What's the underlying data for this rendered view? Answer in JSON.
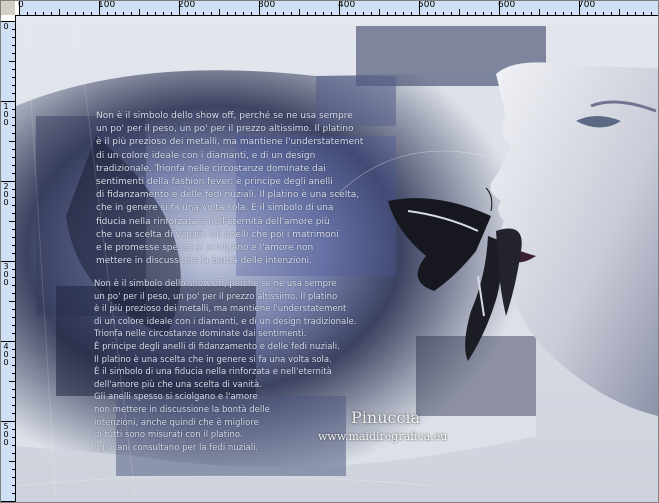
{
  "ruler": {
    "horizontal_labels": [
      "0",
      "100",
      "200",
      "300",
      "400",
      "500",
      "600",
      "700"
    ],
    "vertical_labels": [
      "0",
      "100",
      "200",
      "300",
      "400",
      "500",
      "600"
    ]
  },
  "artwork": {
    "paragraph_1": [
      "Non è il simbolo dello show off, perché se ne usa sempre",
      "un po' per il peso, un po' per il prezzo altissimo. Il platino",
      "è il più prezioso dei metalli, ma mantiene l'understatement",
      "di un colore ideale con i diamanti, e di un design",
      "tradizionale. Trionfa nelle circostanze dominate dai",
      "sentimenti della fashion fever: è principe degli anelli",
      "di fidanzamento e delle fedi nuziali. Il platino è una scelta,",
      "che in genere si fa una volta sola. È il simbolo di una",
      "fiducia nella rinforzata e nell'eternità dell'amore più",
      "che una scelta di vanità. Gli anelli che poi i matrimoni",
      "e le promesse spesso si sciolgano e l'amore non",
      "mettere in discussione la bontà delle intenzioni."
    ],
    "paragraph_2": [
      "Non è il simbolo dello show off, perché se ne usa sempre",
      "un po' per il peso, un po' per il prezzo altissimo. Il platino",
      "è il più prezioso dei metalli, ma mantiene l'understatement",
      "di un colore ideale con i diamanti, e di un design tradizionale.",
      "Trionfa nelle circostanze dominate dai sentimenti.",
      "È principe degli anelli di fidanzamento e delle fedi nuziali.",
      "Il platino è una scelta che in genere si fa una volta sola.",
      "È il simbolo di una fiducia nella rinforzata e nell'eternità",
      "dell'amore più che una scelta di vanità.",
      "Gli anelli spesso si sciolgano e l'amore",
      "non mettere in discussione la bontà delle",
      "intenzioni, anche quindi che è migliore",
      "di tutti sono misurati con il platino.",
      "I giovani consultano per la fedi nuziali."
    ],
    "watermark_name": "Pinuccia",
    "watermark_url": "www.maidiregrafica.eu"
  },
  "colors": {
    "ruler_selection": "#cfe0f5",
    "canvas_bg": "#dfe3ea",
    "accent_blue": "#4a5a9a"
  }
}
